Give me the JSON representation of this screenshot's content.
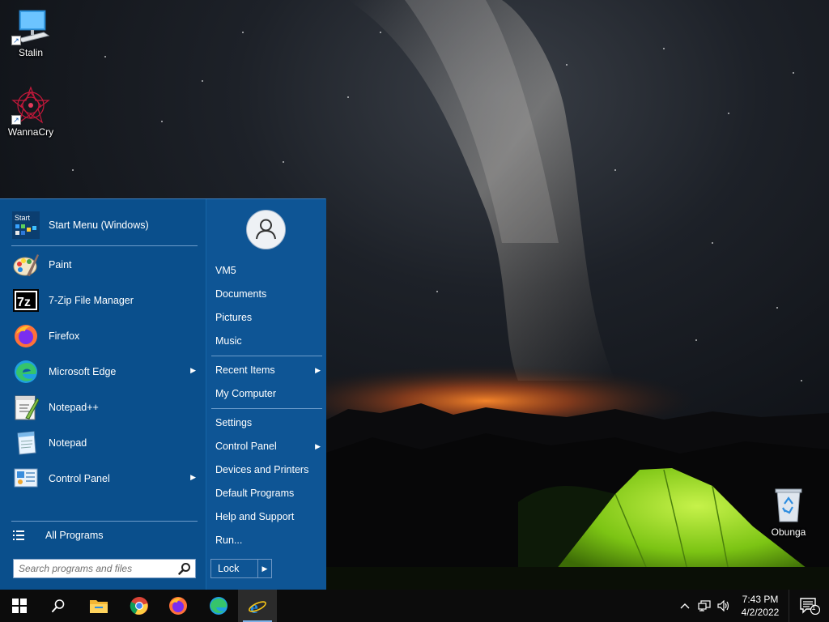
{
  "desktop": {
    "icons": [
      {
        "label": "Stalin",
        "icon": "computer-monitor-icon"
      },
      {
        "label": "WannaCry",
        "icon": "red-star-icon"
      },
      {
        "label": "Obunga",
        "icon": "recycle-bin-icon"
      }
    ]
  },
  "start_menu": {
    "pinned": [
      {
        "label": "Start Menu (Windows)",
        "icon": "start-menu-settings-icon"
      },
      {
        "label": "Paint",
        "icon": "paint-palette-icon"
      },
      {
        "label": "7-Zip File Manager",
        "icon": "7zip-icon",
        "icon_text": "7z"
      },
      {
        "label": "Firefox",
        "icon": "firefox-icon"
      },
      {
        "label": "Microsoft Edge",
        "icon": "edge-icon",
        "has_submenu": true
      },
      {
        "label": "Notepad++",
        "icon": "notepad-plus-plus-icon"
      },
      {
        "label": "Notepad",
        "icon": "notepad-icon"
      },
      {
        "label": "Control Panel",
        "icon": "control-panel-icon",
        "has_submenu": true
      }
    ],
    "start_icon_text": "Start",
    "all_programs": "All Programs",
    "search_placeholder": "Search programs and files",
    "right": {
      "user": "VM5",
      "links_group1": [
        "Documents",
        "Pictures",
        "Music"
      ],
      "recent_items": "Recent Items",
      "my_computer": "My Computer",
      "settings": "Settings",
      "control_panel": "Control Panel",
      "devices_printers": "Devices and Printers",
      "default_programs": "Default Programs",
      "help_support": "Help and Support",
      "run": "Run...",
      "lock": "Lock"
    }
  },
  "taskbar": {
    "apps": [
      "windows-start-icon",
      "search-icon",
      "file-explorer-icon",
      "chrome-icon",
      "firefox-icon",
      "edge-icon",
      "internet-explorer-icon"
    ],
    "clock_time": "7:43 PM",
    "clock_date": "4/2/2022",
    "notification_count": "1"
  },
  "colors": {
    "start_menu_bg": "#0a4f8c",
    "right_pane_bg": "#0e5595",
    "taskbar_bg": "#0c0c0c",
    "tent_green": "#8fd61a"
  }
}
